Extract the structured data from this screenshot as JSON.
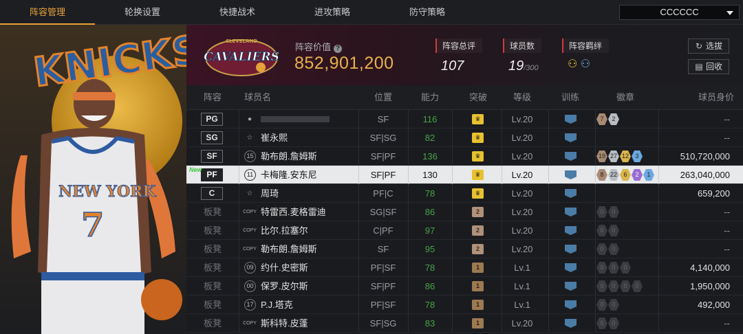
{
  "tabs": [
    {
      "label": "阵容管理",
      "active": true
    },
    {
      "label": "轮换设置",
      "active": false
    },
    {
      "label": "快捷战术",
      "active": false
    },
    {
      "label": "进攻策略",
      "active": false
    },
    {
      "label": "防守策略",
      "active": false
    }
  ],
  "team_select": {
    "value": "CCCCCC"
  },
  "header": {
    "value_label": "阵容价值",
    "value": "852,901,200",
    "stats": [
      {
        "label": "阵容总评",
        "value": "107",
        "sub": ""
      },
      {
        "label": "球员数",
        "value": "19",
        "sub": "/300"
      },
      {
        "label": "阵容羁绊",
        "value": "",
        "sub": ""
      }
    ],
    "buttons": {
      "pick": "选拔",
      "recycle": "回收"
    }
  },
  "columns": [
    "阵容",
    "球员名",
    "位置",
    "能力",
    "突破",
    "等级",
    "训练",
    "徽章",
    "球员身价"
  ],
  "rows": [
    {
      "slot": "PG",
      "bench": false,
      "number": "",
      "name": "",
      "pos": "SF",
      "ability": "116",
      "crown": "gold",
      "crown_text": "",
      "level": "Lv.20",
      "badges": [
        [
          "br",
          "7"
        ],
        [
          "sv",
          "2"
        ]
      ],
      "price": "--"
    },
    {
      "slot": "SG",
      "bench": false,
      "number": "",
      "name": "崔永熙",
      "pos": "SF|SG",
      "ability": "82",
      "crown": "gold",
      "crown_text": "",
      "level": "Lv.20",
      "badges": [],
      "price": "--"
    },
    {
      "slot": "SF",
      "bench": false,
      "number": "15",
      "name": "勒布朗.詹姆斯",
      "pos": "SF|PF",
      "ability": "136",
      "crown": "gold",
      "crown_text": "",
      "level": "Lv.20",
      "badges": [
        [
          "br",
          "19"
        ],
        [
          "sv",
          "27"
        ],
        [
          "gd",
          "12"
        ],
        [
          "bl",
          "3"
        ]
      ],
      "price": "510,720,000"
    },
    {
      "slot": "PF",
      "bench": false,
      "selected": true,
      "new": true,
      "number": "11",
      "name": "卡梅隆.安东尼",
      "pos": "SF|PF",
      "ability": "130",
      "crown": "gold",
      "crown_text": "",
      "level": "Lv.20",
      "badges": [
        [
          "br",
          "8"
        ],
        [
          "sv",
          "22"
        ],
        [
          "gd",
          "6"
        ],
        [
          "pu",
          "2"
        ],
        [
          "bl",
          "1"
        ]
      ],
      "price": "263,040,000"
    },
    {
      "slot": "C",
      "bench": false,
      "number": "",
      "name": "周琦",
      "pos": "PF|C",
      "ability": "78",
      "crown": "gold",
      "crown_text": "",
      "level": "Lv.20",
      "badges": [],
      "price": "659,200"
    },
    {
      "slot": "板凳",
      "bench": true,
      "number": "COPY",
      "name": "特雷西.麦格雷迪",
      "pos": "SG|SF",
      "ability": "86",
      "crown": "tier2",
      "crown_text": "2",
      "level": "Lv.20",
      "badges": [
        [
          "dk",
          "0"
        ],
        [
          "dk",
          "0"
        ]
      ],
      "price": "--"
    },
    {
      "slot": "板凳",
      "bench": true,
      "number": "COPY",
      "name": "比尔.拉塞尔",
      "pos": "C|PF",
      "ability": "97",
      "crown": "tier2",
      "crown_text": "2",
      "level": "Lv.20",
      "badges": [
        [
          "dk",
          "0"
        ],
        [
          "dk",
          "0"
        ]
      ],
      "price": "--"
    },
    {
      "slot": "板凳",
      "bench": true,
      "number": "COPY",
      "name": "勒布朗.詹姆斯",
      "pos": "SF",
      "ability": "95",
      "crown": "tier2",
      "crown_text": "2",
      "level": "Lv.20",
      "badges": [
        [
          "dk",
          "0"
        ],
        [
          "dk",
          "0"
        ]
      ],
      "price": "--"
    },
    {
      "slot": "板凳",
      "bench": true,
      "number": "09",
      "name": "约什.史密斯",
      "pos": "PF|SF",
      "ability": "78",
      "crown": "tier1",
      "crown_text": "1",
      "level": "Lv.1",
      "badges": [
        [
          "dk",
          "0"
        ],
        [
          "dk",
          "0"
        ],
        [
          "dk",
          "0"
        ]
      ],
      "price": "4,140,000"
    },
    {
      "slot": "板凳",
      "bench": true,
      "number": "00",
      "name": "保罗.皮尔斯",
      "pos": "SF|PF",
      "ability": "86",
      "crown": "tier1",
      "crown_text": "1",
      "level": "Lv.1",
      "badges": [
        [
          "dk",
          "0"
        ],
        [
          "dk",
          "0"
        ],
        [
          "dk",
          "0"
        ],
        [
          "dk",
          "0"
        ]
      ],
      "price": "1,950,000"
    },
    {
      "slot": "板凳",
      "bench": true,
      "number": "17",
      "name": "P.J.塔克",
      "pos": "PF|SF",
      "ability": "78",
      "crown": "tier1",
      "crown_text": "1",
      "level": "Lv.1",
      "badges": [
        [
          "dk",
          "0"
        ],
        [
          "dk",
          "0"
        ]
      ],
      "price": "492,000"
    },
    {
      "slot": "板凳",
      "bench": true,
      "number": "COPY",
      "name": "斯科特.皮蓬",
      "pos": "SF|SG",
      "ability": "83",
      "crown": "tier1",
      "crown_text": "1",
      "level": "Lv.20",
      "badges": [
        [
          "dk",
          "0"
        ],
        [
          "dk",
          "0"
        ]
      ],
      "price": "--"
    }
  ],
  "hero": {
    "jersey_text": "NEW YORK",
    "jersey_number": "7",
    "team_wordmark": "KNICKS"
  },
  "logo": {
    "wordmark": "CAVALIERS",
    "sub": "CLEVELAND"
  }
}
